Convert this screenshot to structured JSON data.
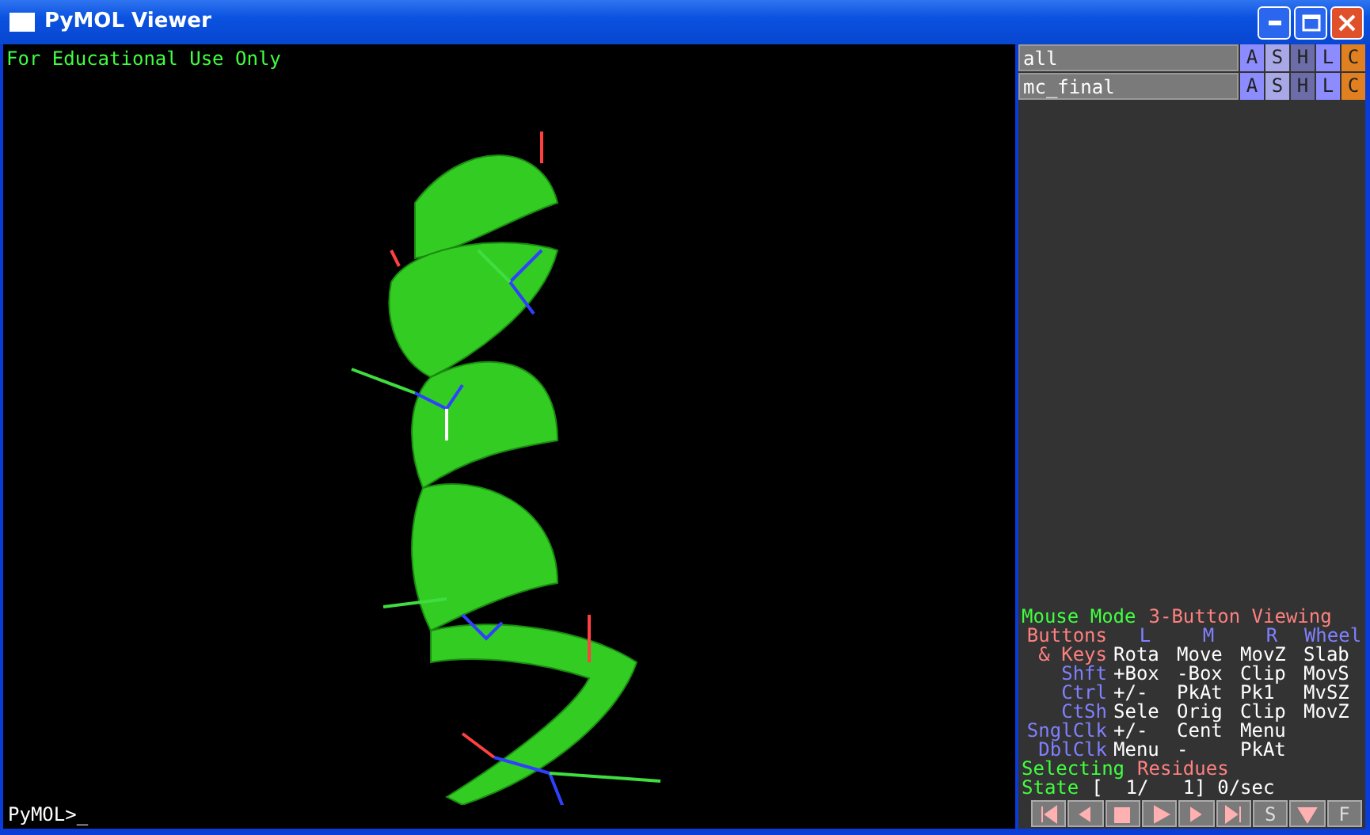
{
  "window": {
    "title": "PyMOL Viewer"
  },
  "viewport": {
    "overlay_text": "For Educational Use Only"
  },
  "command_line": {
    "value": "PyMOL>_"
  },
  "objects": [
    {
      "name": "all",
      "buttons": [
        {
          "label": "A",
          "color": "#8c8cff"
        },
        {
          "label": "S",
          "color": "#a8a8e8"
        },
        {
          "label": "H",
          "color": "#6c6ca8"
        },
        {
          "label": "L",
          "color": "#8c8cff"
        },
        {
          "label": "C",
          "color": "#e08020"
        }
      ]
    },
    {
      "name": "mc_final",
      "buttons": [
        {
          "label": "A",
          "color": "#8c8cff"
        },
        {
          "label": "S",
          "color": "#a8a8e8"
        },
        {
          "label": "H",
          "color": "#6c6ca8"
        },
        {
          "label": "L",
          "color": "#8c8cff"
        },
        {
          "label": "C",
          "color": "#e08020"
        }
      ]
    }
  ],
  "mouse_mode": {
    "title": [
      {
        "text": "Mouse Mode",
        "color": "#40ff40"
      },
      {
        "text": "3-Button Viewing",
        "color": "#ff8080"
      }
    ],
    "rows": [
      [
        {
          "text": "Buttons",
          "color": "#ff8080"
        },
        {
          "text": "L",
          "color": "#8080ff"
        },
        {
          "text": "M",
          "color": "#8080ff"
        },
        {
          "text": "R",
          "color": "#8080ff"
        },
        {
          "text": "Wheel",
          "color": "#8080ff"
        }
      ],
      [
        {
          "text": "& Keys",
          "color": "#ff8080"
        },
        {
          "text": "Rota",
          "color": "#ffffff"
        },
        {
          "text": "Move",
          "color": "#ffffff"
        },
        {
          "text": "MovZ",
          "color": "#ffffff"
        },
        {
          "text": "Slab",
          "color": "#ffffff"
        }
      ],
      [
        {
          "text": "Shft",
          "color": "#8080ff"
        },
        {
          "text": "+Box",
          "color": "#ffffff"
        },
        {
          "text": "-Box",
          "color": "#ffffff"
        },
        {
          "text": "Clip",
          "color": "#ffffff"
        },
        {
          "text": "MovS",
          "color": "#ffffff"
        }
      ],
      [
        {
          "text": "Ctrl",
          "color": "#8080ff"
        },
        {
          "text": "+/-",
          "color": "#ffffff"
        },
        {
          "text": "PkAt",
          "color": "#ffffff"
        },
        {
          "text": "Pk1",
          "color": "#ffffff"
        },
        {
          "text": "MvSZ",
          "color": "#ffffff"
        }
      ],
      [
        {
          "text": "CtSh",
          "color": "#8080ff"
        },
        {
          "text": "Sele",
          "color": "#ffffff"
        },
        {
          "text": "Orig",
          "color": "#ffffff"
        },
        {
          "text": "Clip",
          "color": "#ffffff"
        },
        {
          "text": "MovZ",
          "color": "#ffffff"
        }
      ],
      [
        {
          "text": "SnglClk",
          "color": "#8080ff"
        },
        {
          "text": "+/-",
          "color": "#ffffff"
        },
        {
          "text": "Cent",
          "color": "#ffffff"
        },
        {
          "text": "Menu",
          "color": "#ffffff"
        }
      ],
      [
        {
          "text": "DblClk",
          "color": "#8080ff"
        },
        {
          "text": "Menu",
          "color": "#ffffff"
        },
        {
          "text": "-",
          "color": "#ffffff"
        },
        {
          "text": "PkAt",
          "color": "#ffffff"
        }
      ]
    ],
    "selecting": [
      {
        "text": "Selecting",
        "color": "#40ff40"
      },
      {
        "text": "Residues",
        "color": "#ff8080"
      }
    ],
    "state": [
      {
        "text": "State",
        "color": "#40ff40"
      },
      {
        "text": "[  1/   1] 0/sec",
        "color": "#ffffff"
      }
    ]
  },
  "movie_controls": [
    {
      "kind": "first"
    },
    {
      "kind": "prev"
    },
    {
      "kind": "stop"
    },
    {
      "kind": "play"
    },
    {
      "kind": "next"
    },
    {
      "kind": "last"
    },
    {
      "kind": "text",
      "label": "S"
    },
    {
      "kind": "down"
    },
    {
      "kind": "text",
      "label": "F"
    }
  ]
}
